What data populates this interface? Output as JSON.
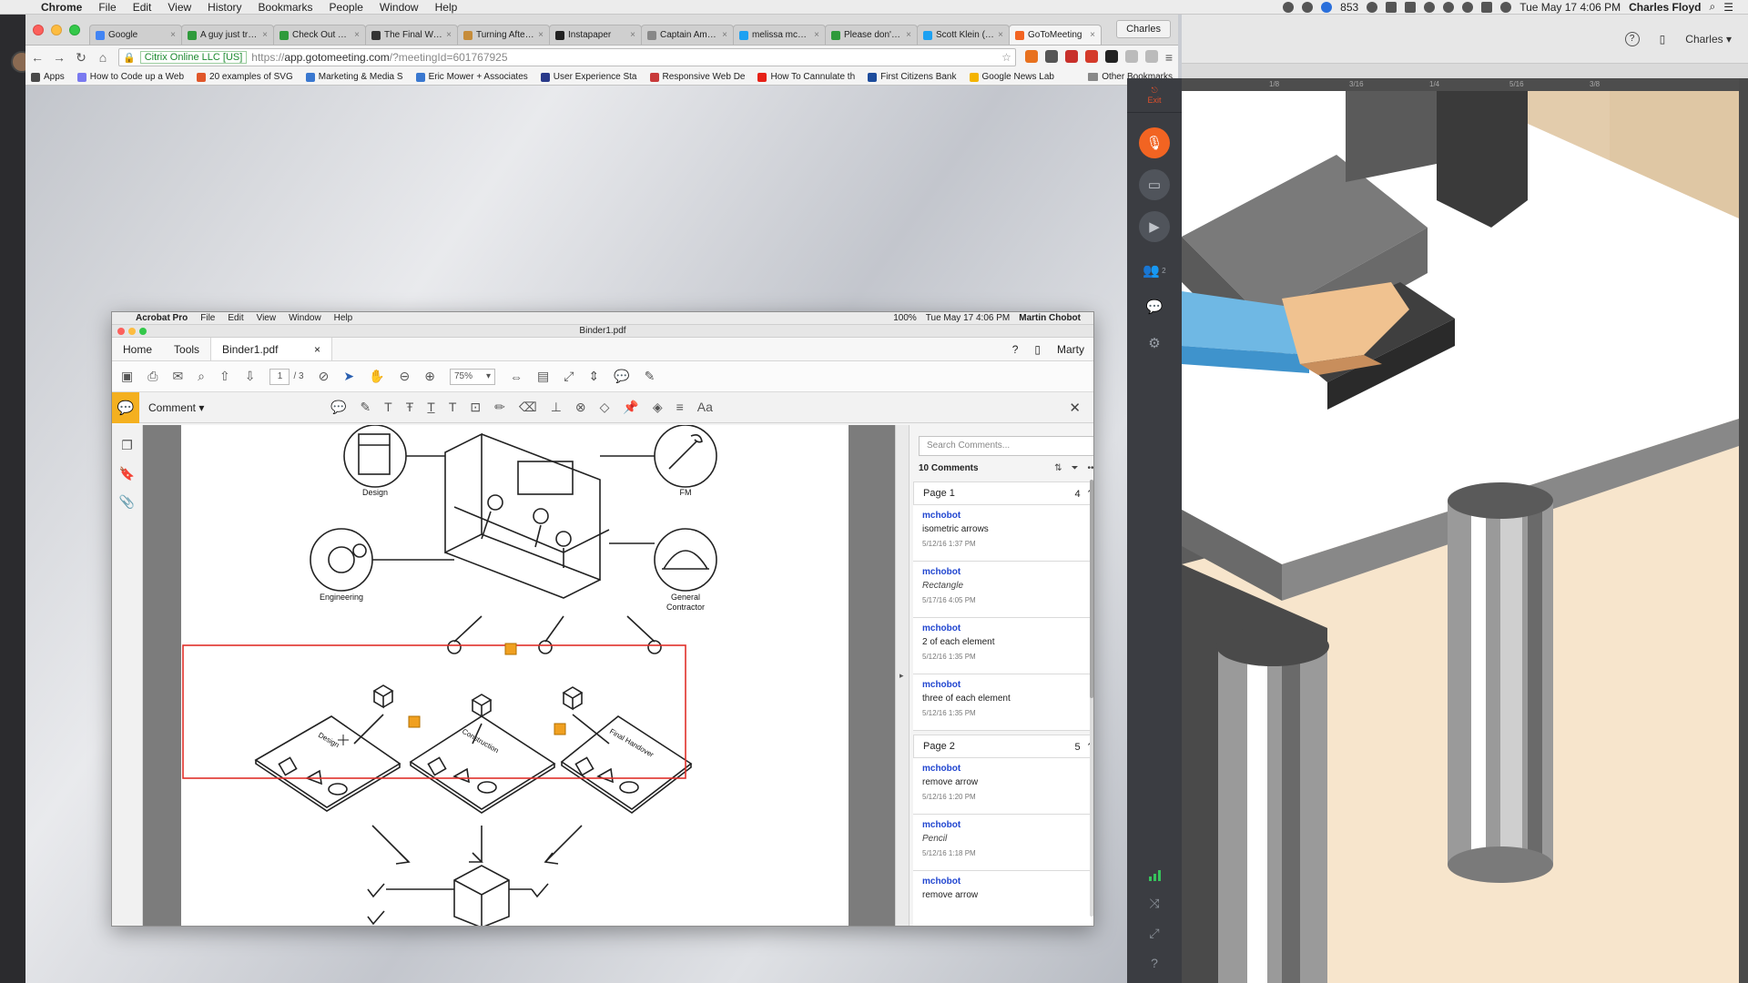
{
  "mac_menubar": {
    "app_name": "Chrome",
    "menus": [
      "File",
      "Edit",
      "View",
      "History",
      "Bookmarks",
      "People",
      "Window",
      "Help"
    ],
    "notification_count": "853",
    "datetime": "Tue May 17  4:06 PM",
    "user": "Charles Floyd"
  },
  "chrome": {
    "tabs": [
      {
        "label": "Google",
        "color": "#4285f4"
      },
      {
        "label": "A guy just transformed",
        "color": "#2f9a3b"
      },
      {
        "label": "Check Out These",
        "color": "#2f9a3b"
      },
      {
        "label": "The Final Word",
        "color": "#333333"
      },
      {
        "label": "Turning After Effects",
        "color": "#c68c3a"
      },
      {
        "label": "Instapaper",
        "color": "#222222"
      },
      {
        "label": "Captain America",
        "color": "#888888"
      },
      {
        "label": "melissa mcewen",
        "color": "#1da1f2"
      },
      {
        "label": "Please don't let",
        "color": "#2f9a3b"
      },
      {
        "label": "Scott Klein (@kleinmatic)",
        "color": "#1da1f2"
      },
      {
        "label": "GoToMeeting",
        "color": "#f26422",
        "active": true
      }
    ],
    "profile_label": "Charles",
    "address": {
      "ev_label": "Citrix Online LLC [US]",
      "url_scheme": "https://",
      "url_host": "app.gotomeeting.com",
      "url_path": "/?meetingId=601767925"
    },
    "bookmarks": [
      {
        "label": "Apps",
        "color": "#4a4a4a"
      },
      {
        "label": "How to Code up a Web",
        "color": "#7a7af0"
      },
      {
        "label": "20 examples of SVG",
        "color": "#e0572a"
      },
      {
        "label": "Marketing & Media S",
        "color": "#3a78d0"
      },
      {
        "label": "Eric Mower + Associates",
        "color": "#3a78d0"
      },
      {
        "label": "User Experience Sta",
        "color": "#2a3a8a"
      },
      {
        "label": "Responsive Web De",
        "color": "#c83a3a"
      },
      {
        "label": "How To Cannulate th",
        "color": "#e62117"
      },
      {
        "label": "First Citizens Bank",
        "color": "#1d4c9c"
      },
      {
        "label": "Google News Lab",
        "color": "#f4b400"
      }
    ],
    "other_bookmarks": "Other Bookmarks"
  },
  "acrobat": {
    "app_name": "Acrobat Pro",
    "menus": [
      "File",
      "Edit",
      "View",
      "Window",
      "Help"
    ],
    "menubar_battery": "100%",
    "menubar_datetime": "Tue May 17  4:06 PM",
    "menubar_user": "Martin Chobot",
    "window_title": "Binder1.pdf",
    "tab_home": "Home",
    "tab_tools": "Tools",
    "tab_doc": "Binder1.pdf",
    "account_label": "Marty",
    "page_current": "1",
    "page_total": "/ 3",
    "zoom": "75%",
    "comment_label": "Comment",
    "search_placeholder": "Search Comments...",
    "comments_count": "10 Comments",
    "groups": [
      {
        "label": "Page 1",
        "count": "4"
      },
      {
        "label": "Page 2",
        "count": "5"
      }
    ],
    "comments": [
      {
        "author": "mchobot",
        "text": "isometric arrows",
        "time": "5/12/16  1:37 PM",
        "italic": false
      },
      {
        "author": "mchobot",
        "text": "Rectangle",
        "time": "5/17/16  4:05 PM",
        "italic": true
      },
      {
        "author": "mchobot",
        "text": "2 of each element",
        "time": "5/12/16  1:35 PM",
        "italic": false
      },
      {
        "author": "mchobot",
        "text": "three of each element",
        "time": "5/12/16  1:35 PM",
        "italic": false
      },
      {
        "author": "mchobot",
        "text": "remove arrow",
        "time": "5/12/16  1:20 PM",
        "italic": false
      },
      {
        "author": "mchobot",
        "text": "Pencil",
        "time": "5/12/16  1:18 PM",
        "italic": true
      },
      {
        "author": "mchobot",
        "text": "remove arrow",
        "time": "",
        "italic": false
      }
    ],
    "drawing_labels": {
      "design": "Design",
      "fm": "FM",
      "engineering": "Engineering",
      "gc_line1": "General",
      "gc_line2": "Contractor",
      "plane_design": "Design",
      "plane_construction": "Construction",
      "plane_handover": "Final Handover"
    },
    "annotation_color": "#e0302a",
    "comment_note_color": "#f0a020"
  },
  "gotomeeting": {
    "exit_label": "Exit",
    "mic_color": "#f26422",
    "attendee_count": "2"
  },
  "right_app": {
    "profile_label": "Charles",
    "ruler_marks": [
      "1/8",
      "3/16",
      "1/4",
      "5/16",
      "3/8"
    ]
  }
}
